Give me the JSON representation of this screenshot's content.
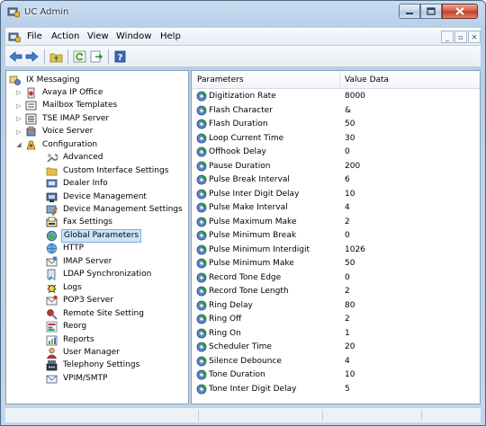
{
  "window": {
    "title": "UC Admin"
  },
  "menu": {
    "items": [
      "File",
      "Action",
      "View",
      "Window",
      "Help"
    ]
  },
  "toolbar": {
    "buttons": [
      "back-arrow-icon",
      "forward-arrow-icon",
      "up-folder-icon",
      "refresh-icon",
      "export-icon",
      "help-icon"
    ]
  },
  "tree": {
    "root": "IX Messaging",
    "items": [
      "Avaya IP Office",
      "Mailbox Templates",
      "TSE IMAP Server",
      "Voice Server",
      "Configuration",
      "Advanced",
      "Custom Interface Settings",
      "Dealer Info",
      "Device Management",
      "Device Management Settings",
      "Fax Settings",
      "Global Parameters",
      "HTTP",
      "IMAP Server",
      "LDAP Synchronization",
      "Logs",
      "POP3 Server",
      "Remote Site Setting",
      "Reorg",
      "Reports",
      "User Manager",
      "Telephony Settings",
      "VPIM/SMTP"
    ],
    "selected": "Global Parameters"
  },
  "list": {
    "columns": [
      "Parameters",
      "Value Data"
    ],
    "rows": [
      [
        "Digitization Rate",
        "8000"
      ],
      [
        "Flash Character",
        "&"
      ],
      [
        "Flash Duration",
        "50"
      ],
      [
        "Loop Current Time",
        "30"
      ],
      [
        "Offhook Delay",
        "0"
      ],
      [
        "Pause Duration",
        "200"
      ],
      [
        "Pulse Break Interval",
        "6"
      ],
      [
        "Pulse Inter Digit Delay",
        "10"
      ],
      [
        "Pulse Make Interval",
        "4"
      ],
      [
        "Pulse Maximum Make",
        "2"
      ],
      [
        "Pulse Minimum Break",
        "0"
      ],
      [
        "Pulse Minimum Interdigit",
        "1026"
      ],
      [
        "Pulse Minimum Make",
        "50"
      ],
      [
        "Record Tone Edge",
        "0"
      ],
      [
        "Record Tone Length",
        "2"
      ],
      [
        "Ring Delay",
        "80"
      ],
      [
        "Ring Off",
        "2"
      ],
      [
        "Ring On",
        "1"
      ],
      [
        "Scheduler Time",
        "20"
      ],
      [
        "Silence Debounce",
        "4"
      ],
      [
        "Tone Duration",
        "10"
      ],
      [
        "Tone Inter Digit Delay",
        "5"
      ]
    ]
  },
  "colors": {
    "selection": "#cde4fb",
    "selection_border": "#84acdd",
    "frame": "#b7cfe8",
    "close": "#c33a22"
  }
}
